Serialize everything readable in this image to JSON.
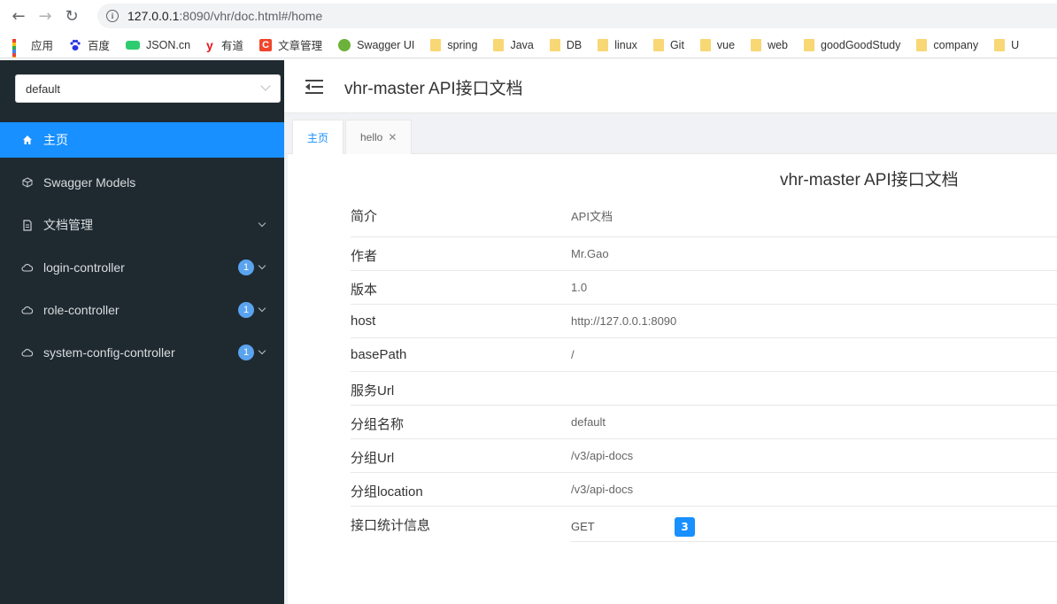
{
  "browser": {
    "url_host": "127.0.0.1",
    "url_path": ":8090/vhr/doc.html#/home",
    "bookmarks": [
      {
        "label": "应用",
        "icon": "apps-grid-icon"
      },
      {
        "label": "百度",
        "icon": "baidu-paw-icon",
        "color": "#2932e1"
      },
      {
        "label": "JSON.cn",
        "icon": "json-icon",
        "color": "#2ecc71"
      },
      {
        "label": "有道",
        "icon": "youdao-icon",
        "color": "#e6161e"
      },
      {
        "label": "文章管理",
        "icon": "csdn-icon",
        "color": "#f0452b"
      },
      {
        "label": "Swagger UI",
        "icon": "swagger-icon",
        "color": "#6cb23a"
      },
      {
        "label": "spring",
        "icon": "folder-icon"
      },
      {
        "label": "Java",
        "icon": "folder-icon"
      },
      {
        "label": "DB",
        "icon": "folder-icon"
      },
      {
        "label": "linux",
        "icon": "folder-icon"
      },
      {
        "label": "Git",
        "icon": "folder-icon"
      },
      {
        "label": "vue",
        "icon": "folder-icon"
      },
      {
        "label": "web",
        "icon": "folder-icon"
      },
      {
        "label": "goodGoodStudy",
        "icon": "folder-icon"
      },
      {
        "label": "company",
        "icon": "folder-icon"
      },
      {
        "label": "U",
        "icon": "folder-icon"
      }
    ]
  },
  "sidebar": {
    "group_select": "default",
    "items": [
      {
        "label": "主页",
        "icon": "home-icon",
        "active": true
      },
      {
        "label": "Swagger Models",
        "icon": "cube-icon"
      },
      {
        "label": "文档管理",
        "icon": "doc-icon",
        "expandable": true
      },
      {
        "label": "login-controller",
        "icon": "cloud-icon",
        "badge": "1",
        "expandable": true
      },
      {
        "label": "role-controller",
        "icon": "cloud-icon",
        "badge": "1",
        "expandable": true
      },
      {
        "label": "system-config-controller",
        "icon": "cloud-icon",
        "badge": "1",
        "expandable": true
      }
    ]
  },
  "header": {
    "title": "vhr-master API接口文档"
  },
  "tabs": [
    {
      "label": "主页",
      "active": true
    },
    {
      "label": "hello",
      "closable": true
    }
  ],
  "doc": {
    "title": "vhr-master API接口文档",
    "rows": [
      {
        "label": "简介",
        "value": "API文档"
      },
      {
        "label": "作者",
        "value": "Mr.Gao"
      },
      {
        "label": "版本",
        "value": "1.0"
      },
      {
        "label": "host",
        "value": "http://127.0.0.1:8090"
      },
      {
        "label": "basePath",
        "value": "/"
      },
      {
        "label": "服务Url",
        "value": ""
      },
      {
        "label": "分组名称",
        "value": "default"
      },
      {
        "label": "分组Url",
        "value": "/v3/api-docs"
      },
      {
        "label": "分组location",
        "value": "/v3/api-docs"
      }
    ],
    "stats": {
      "label": "接口统计信息",
      "method": "GET",
      "count": "3"
    }
  },
  "colors": {
    "accent": "#1890ff",
    "sidebar_bg": "#1f2a30"
  }
}
